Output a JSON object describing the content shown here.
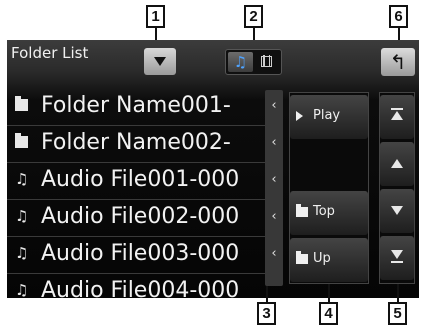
{
  "callouts": [
    "1",
    "2",
    "3",
    "4",
    "5",
    "6"
  ],
  "header": {
    "title": "Folder List",
    "tabs": [
      {
        "icon": "music-note-icon",
        "glyph": "♫",
        "selected": true
      },
      {
        "icon": "film-icon",
        "selected": false
      }
    ],
    "back_glyph": "↰"
  },
  "list": {
    "items": [
      {
        "type": "folder",
        "icon": "folder-icon",
        "label": "Folder Name001-"
      },
      {
        "type": "folder",
        "icon": "folder-icon",
        "label": "Folder Name002-"
      },
      {
        "type": "audio",
        "icon": "music-note-icon",
        "glyph": "♫",
        "label": "Audio File001-000"
      },
      {
        "type": "audio",
        "icon": "music-note-icon",
        "glyph": "♫",
        "label": "Audio File002-000"
      },
      {
        "type": "audio",
        "icon": "music-note-icon",
        "glyph": "♫",
        "label": "Audio File003-000"
      },
      {
        "type": "audio",
        "icon": "music-note-icon",
        "glyph": "♫",
        "label": "Audio File004-000"
      }
    ],
    "expand_glyph": "‹"
  },
  "controls": {
    "play_label": "Play",
    "top_label": "Top",
    "up_label": "Up"
  },
  "colors": {
    "accent": "#4fa3ff",
    "background": "#050505",
    "text": "#f2f2f2"
  }
}
